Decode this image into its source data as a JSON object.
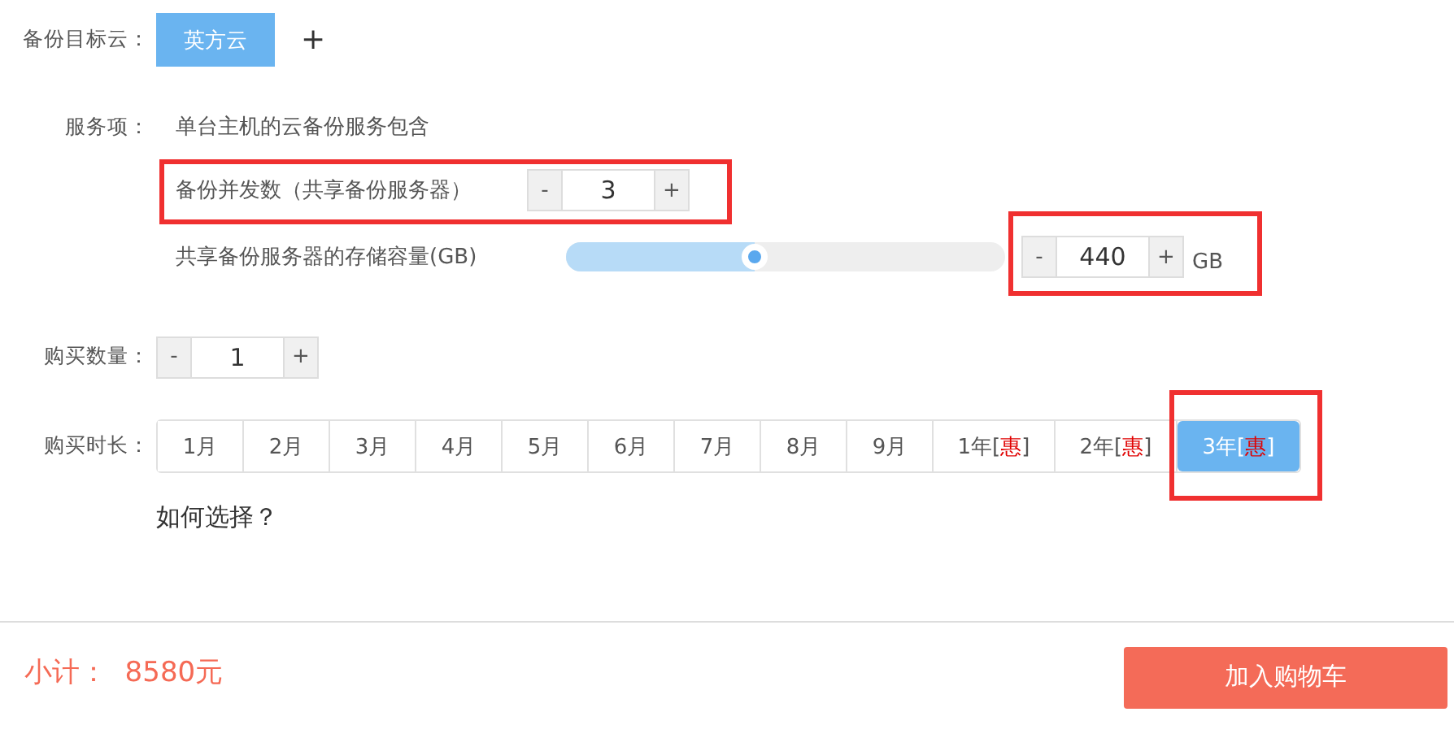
{
  "target_cloud": {
    "label": "备份目标云：",
    "options": [
      {
        "label": "英方云",
        "selected": true
      }
    ],
    "add_button": "+"
  },
  "service": {
    "label": "服务项：",
    "description": "单台主机的云备份服务包含",
    "concurrency": {
      "label": "备份并发数（共享备份服务器）",
      "minus": "-",
      "value": "3",
      "plus": "+"
    },
    "storage": {
      "label": "共享备份服务器的存储容量(GB)",
      "level": 0.43,
      "minus": "-",
      "value": "440",
      "plus": "+",
      "unit": "GB"
    }
  },
  "quantity": {
    "label": "购买数量：",
    "minus": "-",
    "value": "1",
    "plus": "+"
  },
  "duration": {
    "label": "购买时长：",
    "options": [
      {
        "label": "1月",
        "selected": false
      },
      {
        "label": "2月",
        "selected": false
      },
      {
        "label": "3月",
        "selected": false
      },
      {
        "label": "4月",
        "selected": false
      },
      {
        "label": "5月",
        "selected": false
      },
      {
        "label": "6月",
        "selected": false
      },
      {
        "label": "7月",
        "selected": false
      },
      {
        "label": "8月",
        "selected": false
      },
      {
        "label": "9月",
        "selected": false
      },
      {
        "label": "1年[",
        "badge": "惠",
        "suffix": "]",
        "selected": false
      },
      {
        "label": "2年[",
        "badge": "惠",
        "suffix": "]",
        "selected": false
      },
      {
        "label": "3年[",
        "badge": "惠",
        "suffix": "]",
        "selected": true
      }
    ],
    "help_link": "如何选择？"
  },
  "footer": {
    "subtotal": "小计：  8580元",
    "cart_button": "加入购物车"
  }
}
